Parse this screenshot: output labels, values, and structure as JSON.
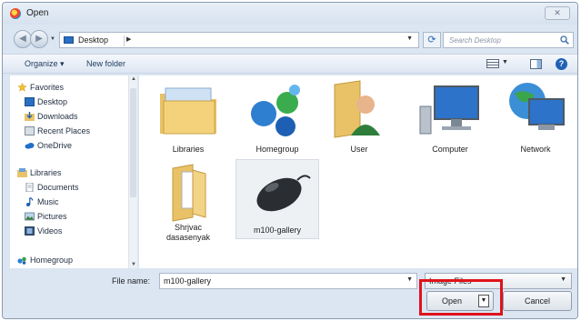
{
  "window": {
    "title": "Open",
    "close_glyph": "✕"
  },
  "address": {
    "path": "Desktop",
    "search_placeholder": "Search Desktop"
  },
  "toolbar": {
    "organize": "Organize ▾",
    "new_folder": "New folder",
    "help": "?"
  },
  "nav": {
    "favorites": "Favorites",
    "favorites_items": [
      "Desktop",
      "Downloads",
      "Recent Places",
      "OneDrive"
    ],
    "libraries": "Libraries",
    "libraries_items": [
      "Documents",
      "Music",
      "Pictures",
      "Videos"
    ],
    "homegroup": "Homegroup"
  },
  "items": [
    {
      "label": "Libraries",
      "icon": "libraries-folder-icon"
    },
    {
      "label": "Homegroup",
      "icon": "homegroup-icon"
    },
    {
      "label": "User",
      "icon": "user-folder-icon"
    },
    {
      "label": "Computer",
      "icon": "computer-icon"
    },
    {
      "label": "Network",
      "icon": "network-icon"
    },
    {
      "label": "Shrjvac\ndasasenyak",
      "icon": "folder-icon"
    },
    {
      "label": "m100-gallery",
      "icon": "mouse-image-icon"
    }
  ],
  "footer": {
    "file_name_label": "File name:",
    "file_name_value": "m100-gallery",
    "filter_value": "Image Files",
    "open_label": "Open",
    "cancel_label": "Cancel"
  },
  "colors": {
    "highlight": "#e0121a",
    "accent": "#1f62b5"
  }
}
